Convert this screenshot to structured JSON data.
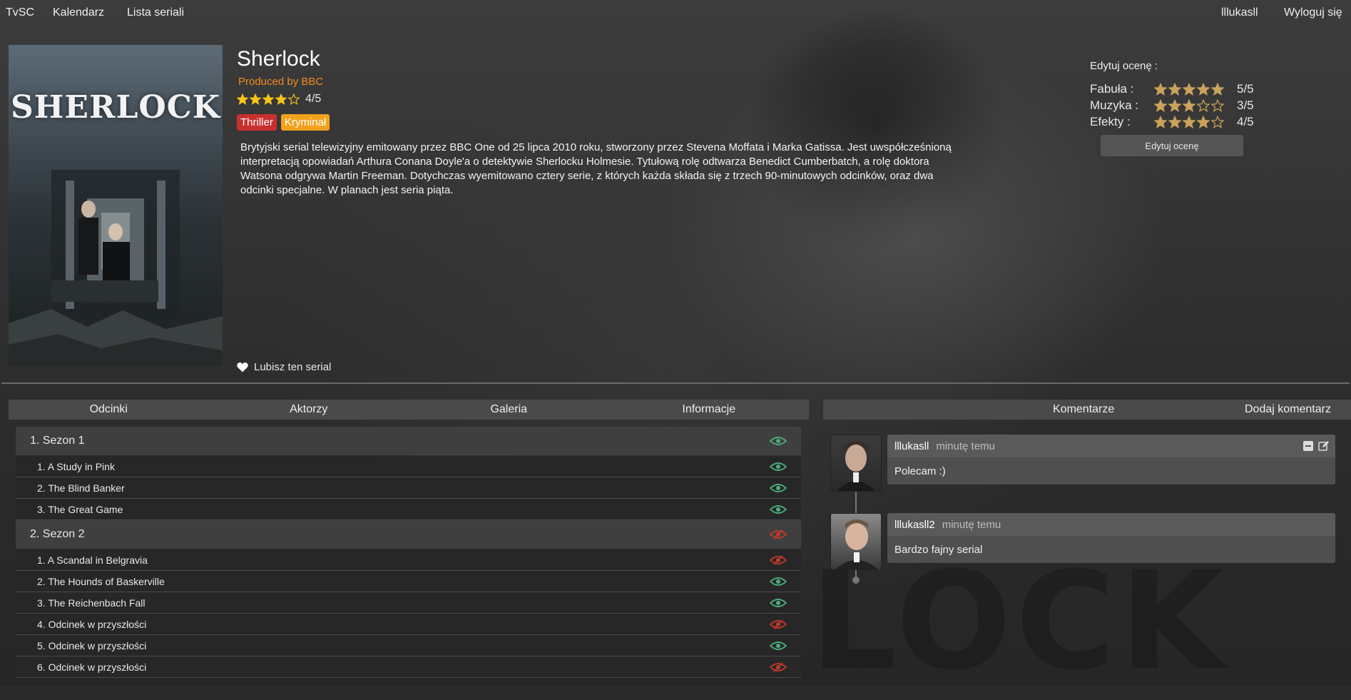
{
  "nav": {
    "brand": "TvSC",
    "calendar": "Kalendarz",
    "series_list": "Lista seriali",
    "user": "lllukasll",
    "logout": "Wyloguj się"
  },
  "poster": {
    "title": "SHERLOCK"
  },
  "show": {
    "title": "Sherlock",
    "producer": "Produced by BBC",
    "rating": "4/5",
    "rating_value": 4,
    "tags": [
      {
        "label": "Thriller",
        "color": "#c7302f"
      },
      {
        "label": "Kryminał",
        "color": "#f2a11c"
      }
    ],
    "description": "Brytyjski serial telewizyjny emitowany przez BBC One od 25 lipca 2010 roku, stworzony przez Stevena Moffata i Marka Gatissa. Jest uwspółcześnioną interpretacją opowiadań Arthura Conana Doyle'a o detektywie Sherlocku Holmesie. Tytułową rolę odtwarza Benedict Cumberbatch, a rolę doktora Watsona odgrywa Martin Freeman. Dotychczas wyemitowano cztery serie, z których każda składa się z trzech 90-minutowych odcinków, oraz dwa odcinki specjalne. W planach jest seria piąta.",
    "like_label": "Lubisz ten serial"
  },
  "ratings": {
    "heading": "Edytuj ocenę :",
    "rows": [
      {
        "label": "Fabuła :",
        "value": "5/5",
        "stars": 5
      },
      {
        "label": "Muzyka :",
        "value": "3/5",
        "stars": 3
      },
      {
        "label": "Efekty :",
        "value": "4/5",
        "stars": 4
      }
    ],
    "edit_button": "Edytuj ocenę"
  },
  "tabs": [
    "Odcinki",
    "Aktorzy",
    "Galeria",
    "Informacje"
  ],
  "comments_bar": {
    "title": "Komentarze",
    "add": "Dodaj komentarz"
  },
  "seasons": [
    {
      "title": "1. Sezon 1",
      "watched": true,
      "episodes": [
        {
          "title": "1. A Study in Pink",
          "watched": true
        },
        {
          "title": "2. The Blind Banker",
          "watched": true
        },
        {
          "title": "3. The Great Game",
          "watched": true
        }
      ]
    },
    {
      "title": "2. Sezon 2",
      "watched": false,
      "episodes": [
        {
          "title": "1. A Scandal in Belgravia",
          "watched": false
        },
        {
          "title": "2. The Hounds of Baskerville",
          "watched": true
        },
        {
          "title": "3. The Reichenbach Fall",
          "watched": true
        },
        {
          "title": "4. Odcinek w przyszłości",
          "watched": false
        },
        {
          "title": "5. Odcinek w przyszłości",
          "watched": true
        },
        {
          "title": "6. Odcinek w przyszłości",
          "watched": false
        }
      ]
    }
  ],
  "comments": [
    {
      "author": "lllukasll",
      "time": "minutę temu",
      "text": "Polecam :)",
      "own": true
    },
    {
      "author": "lllukasll2",
      "time": "minutę temu",
      "text": "Bardzo fajny serial",
      "own": false
    }
  ],
  "colors": {
    "watched": "#4caf7a",
    "unwatched": "#c0392b",
    "star": "#f5c518",
    "rating_star": "#caa25a",
    "producer": "#f08c1e"
  }
}
